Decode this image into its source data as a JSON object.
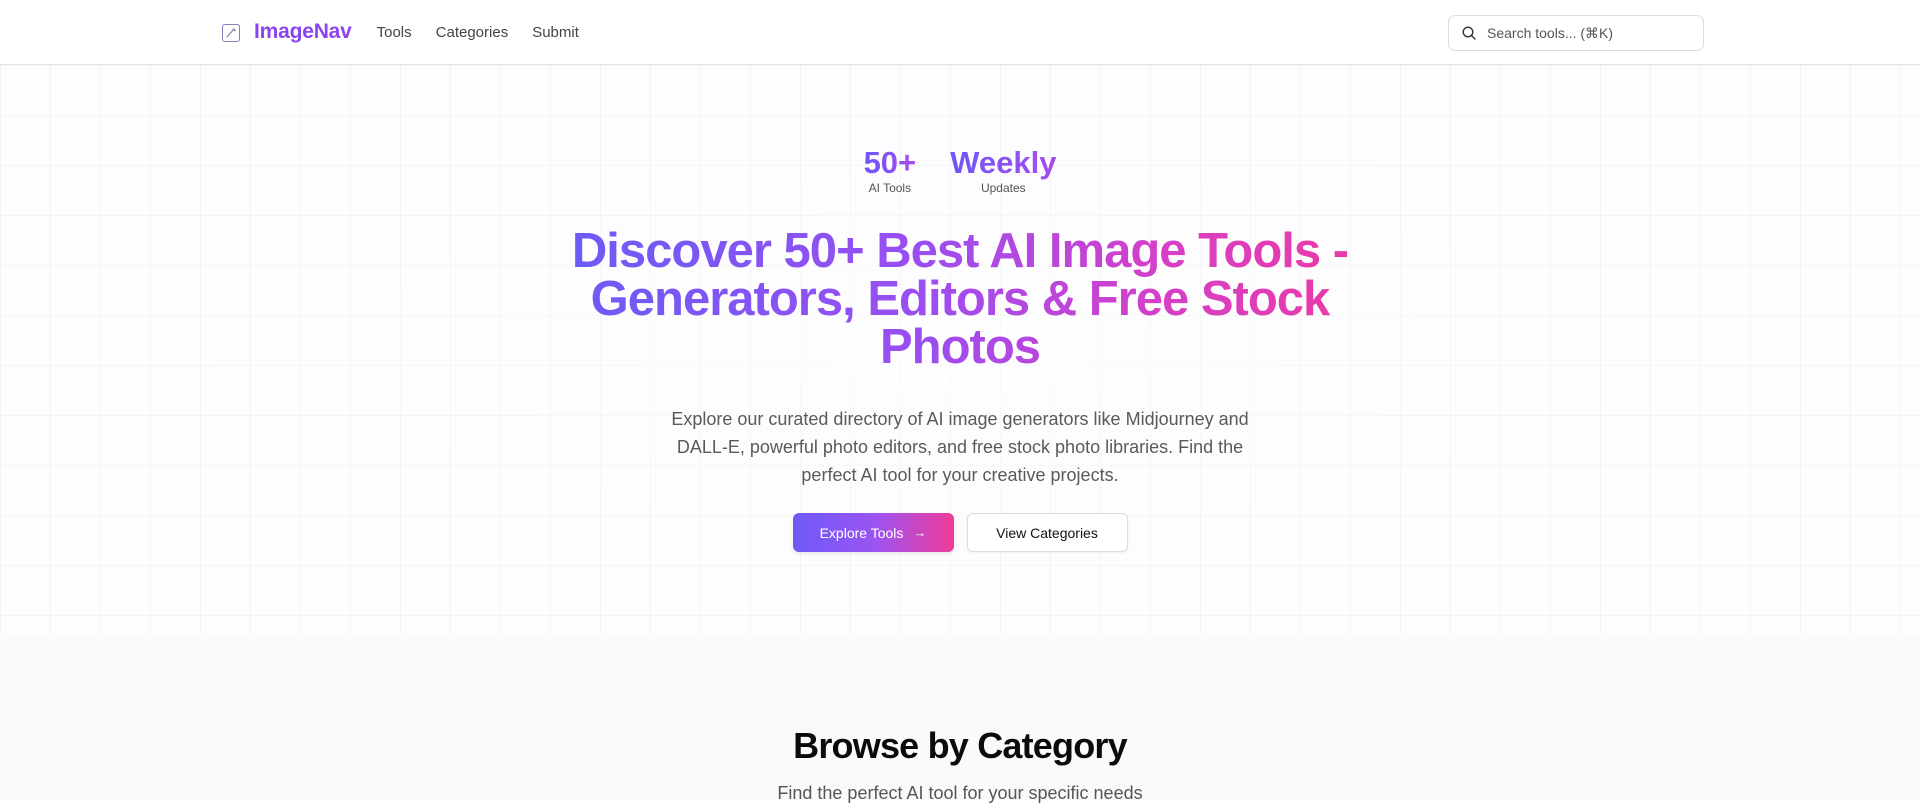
{
  "header": {
    "brand": "ImageNav",
    "nav": [
      {
        "label": "Tools"
      },
      {
        "label": "Categories"
      },
      {
        "label": "Submit"
      }
    ],
    "search_placeholder": "Search tools... (⌘K)"
  },
  "hero": {
    "stats": [
      {
        "value": "50+",
        "label": "AI Tools"
      },
      {
        "value": "Weekly",
        "label": "Updates"
      }
    ],
    "title": "Discover 50+ Best AI Image Tools - Generators, Editors & Free Stock Photos",
    "description": "Explore our curated directory of AI image generators like Midjourney and DALL-E, powerful photo editors, and free stock photo libraries. Find the perfect AI tool for your creative projects.",
    "primary_button": "Explore Tools",
    "secondary_button": "View Categories"
  },
  "browse": {
    "title": "Browse by Category",
    "subtitle": "Find the perfect AI tool for your specific needs"
  },
  "colors": {
    "brand": "#8b44f0",
    "gradient_start": "#6a5cf6",
    "gradient_end": "#ec3aa4"
  }
}
